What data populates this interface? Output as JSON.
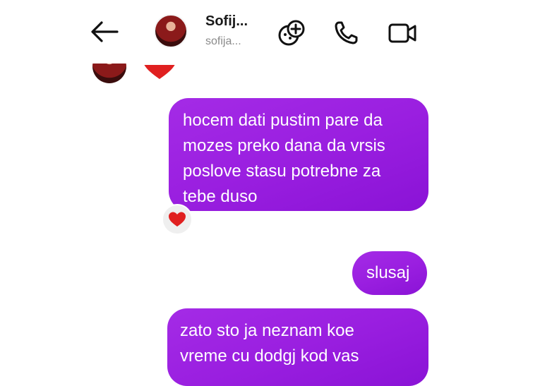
{
  "header": {
    "contact_name": "Sofij...",
    "contact_handle": "sofija...",
    "icons": [
      "back-arrow-icon",
      "effects-icon",
      "phone-icon",
      "video-camera-icon"
    ]
  },
  "messages": [
    {
      "sender": "me",
      "lines": [
        "hocem dati pustim pare  da",
        "mozes preko dana da vrsis",
        "poslove stasu potrebne  za",
        "tebe duso"
      ],
      "reaction": "heart"
    },
    {
      "sender": "me",
      "lines": [
        "slusaj"
      ]
    },
    {
      "sender": "me",
      "lines": [
        "zato sto ja neznam koe",
        "vreme cu dodgj kod vas"
      ]
    }
  ],
  "colors": {
    "bubble": "#9a1fe0",
    "heart": "#e02020"
  }
}
